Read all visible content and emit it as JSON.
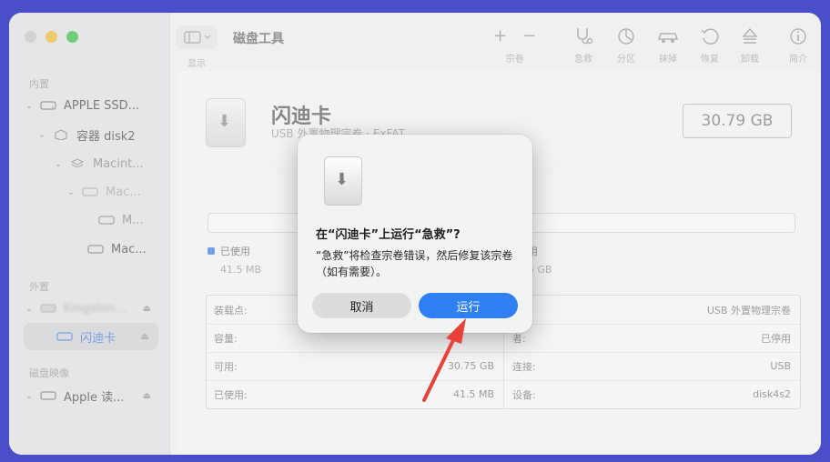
{
  "app": {
    "title": "磁盘工具"
  },
  "toolbar": {
    "view_label": "显示",
    "items": [
      {
        "label": "宗卷",
        "icon": "plus-minus-icon"
      },
      {
        "label": "急救",
        "icon": "stethoscope-icon"
      },
      {
        "label": "分区",
        "icon": "pie-icon"
      },
      {
        "label": "抹掉",
        "icon": "car-icon"
      },
      {
        "label": "恢复",
        "icon": "restore-icon"
      },
      {
        "label": "卸载",
        "icon": "eject-icon"
      },
      {
        "label": "简介",
        "icon": "info-icon"
      }
    ]
  },
  "sidebar": {
    "section_internal": "内置",
    "section_external": "外置",
    "section_images": "磁盘映像",
    "items": [
      {
        "label": "APPLE SSD..."
      },
      {
        "label": "容器 disk2"
      },
      {
        "label": "Macint..."
      },
      {
        "label": "Mac..."
      },
      {
        "label": "M..."
      },
      {
        "label": "Mac..."
      },
      {
        "label": "Kingston..."
      },
      {
        "label": "闪迪卡"
      },
      {
        "label": "Apple 读..."
      }
    ]
  },
  "device": {
    "name": "闪迪卡",
    "subtitle": "USB 外置物理宗卷 · ExFAT",
    "size": "30.79 GB",
    "used_label": "已使用",
    "used_value": "41.5 MB",
    "free_label": "用",
    "free_value": "5 GB"
  },
  "info": {
    "left": [
      {
        "k": "装载点:",
        "v": ""
      },
      {
        "k": "容量:",
        "v": ""
      },
      {
        "k": "可用:",
        "v": "30.75 GB"
      },
      {
        "k": "已使用:",
        "v": "41.5 MB"
      }
    ],
    "right": [
      {
        "k": "",
        "v": "USB 外置物理宗卷"
      },
      {
        "k": "者:",
        "v": "已停用"
      },
      {
        "k": "连接:",
        "v": "USB"
      },
      {
        "k": "设备:",
        "v": "disk4s2"
      }
    ]
  },
  "dialog": {
    "title": "在“闪迪卡”上运行“急救”?",
    "message": "“急救”将检查宗卷错误，然后修复该宗卷（如有需要）。",
    "cancel_label": "取消",
    "run_label": "运行"
  },
  "colors": {
    "accent": "#2f7ff5",
    "annotation_arrow": "#e8413a",
    "background": "#4a4fc9"
  }
}
